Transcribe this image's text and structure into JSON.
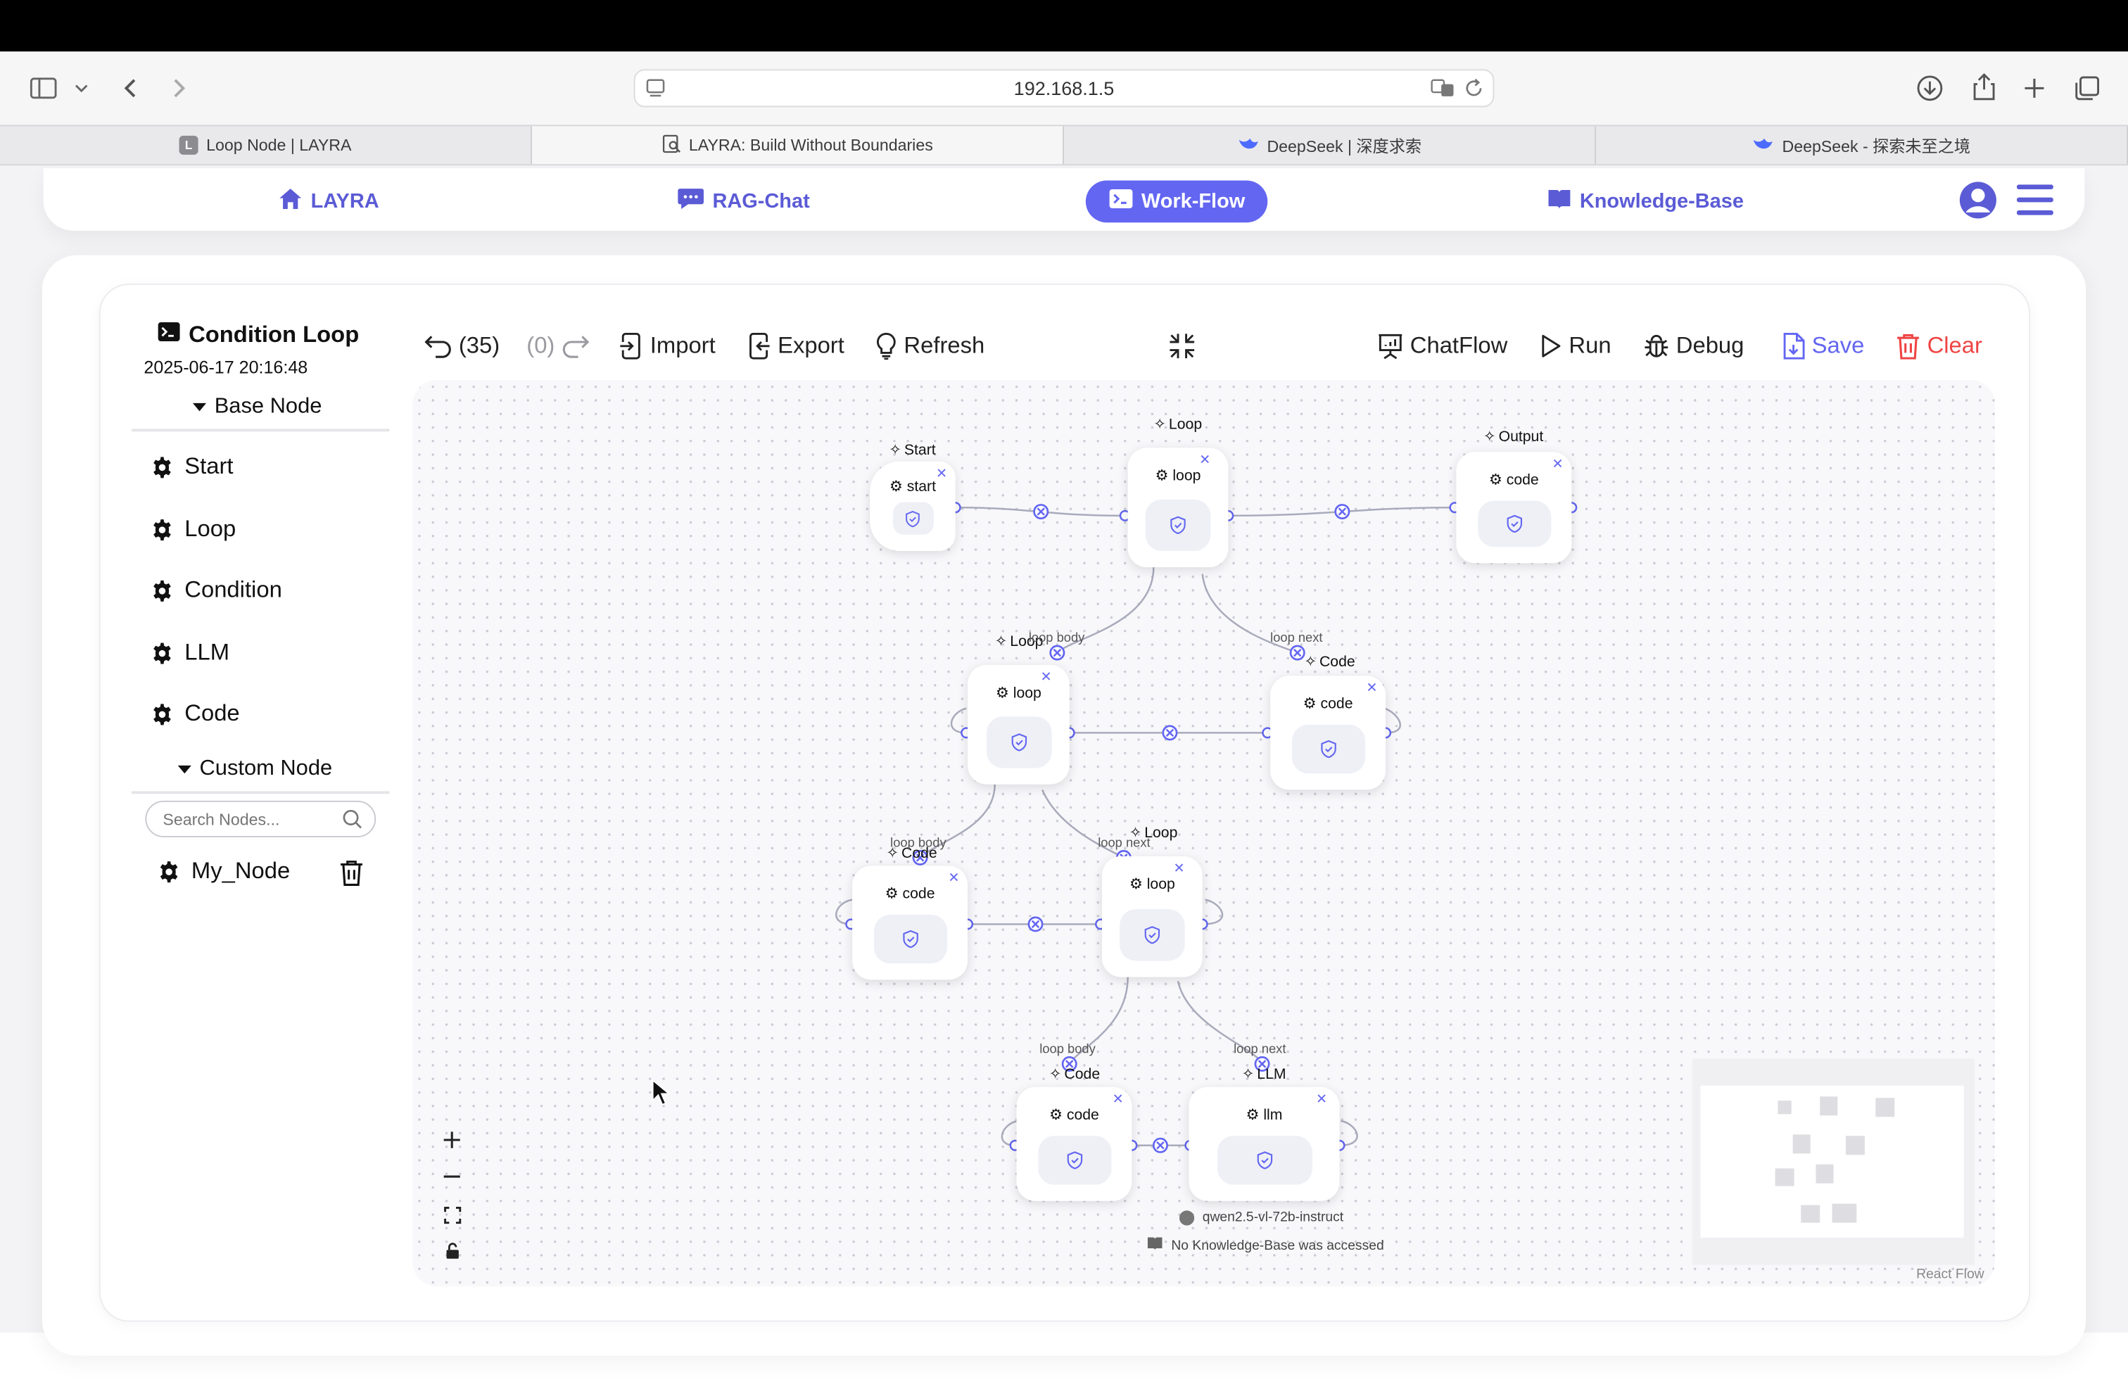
{
  "browser": {
    "url": "192.168.1.5",
    "tabs": [
      {
        "title": "Loop Node | LAYRA",
        "favicon": "L"
      },
      {
        "title": "LAYRA: Build Without Boundaries",
        "favicon": "doc-search-icon"
      },
      {
        "title": "DeepSeek | 深度求索",
        "favicon": "deepseek-whale-icon"
      },
      {
        "title": "DeepSeek - 探索未至之境",
        "favicon": "deepseek-whale-icon"
      }
    ]
  },
  "nav": {
    "items": [
      {
        "label": "LAYRA",
        "icon": "home-icon"
      },
      {
        "label": "RAG-Chat",
        "icon": "chat-bubble-icon"
      },
      {
        "label": "Work-Flow",
        "icon": "terminal-icon",
        "active": true
      },
      {
        "label": "Knowledge-Base",
        "icon": "book-icon"
      }
    ],
    "accent": "#6366f1"
  },
  "workflow": {
    "title": "Condition Loop",
    "timestamp": "2025-06-17 20:16:48"
  },
  "sidebar": {
    "base_header": "Base Node",
    "base_nodes": [
      "Start",
      "Loop",
      "Condition",
      "LLM",
      "Code"
    ],
    "custom_header": "Custom Node",
    "search_placeholder": "Search Nodes...",
    "custom_nodes": [
      "My_Node"
    ]
  },
  "toolbar": {
    "undo_count": "(35)",
    "redo_count": "(0)",
    "import": "Import",
    "export": "Export",
    "refresh": "Refresh",
    "chatflow": "ChatFlow",
    "run": "Run",
    "debug": "Debug",
    "save": "Save",
    "clear": "Clear",
    "save_color": "#6366f1",
    "clear_color": "#ef4444"
  },
  "canvas": {
    "nodes": [
      {
        "title": "Start",
        "label": "start"
      },
      {
        "title": "Loop",
        "label": "loop"
      },
      {
        "title": "Output",
        "label": "code"
      },
      {
        "title": "Loop",
        "label": "loop"
      },
      {
        "title": "Code",
        "label": "code"
      },
      {
        "title": "Code",
        "label": "code"
      },
      {
        "title": "Loop",
        "label": "loop"
      },
      {
        "title": "Code",
        "label": "code"
      },
      {
        "title": "LLM",
        "label": "llm"
      }
    ],
    "edge_labels": [
      "loop body",
      "loop next",
      "loop body",
      "loop next",
      "loop body",
      "loop next"
    ],
    "llm_model": "qwen2.5-vl-72b-instruct",
    "llm_kb": "No Knowledge-Base was accessed",
    "attribution": "React Flow"
  }
}
